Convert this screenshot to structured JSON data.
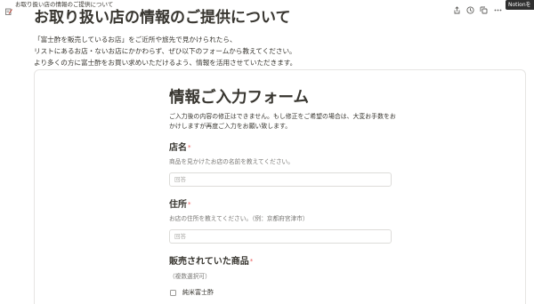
{
  "window": {
    "breadcrumb": "お取り扱い店の情報のご提供について",
    "breadcrumb_icon": "note-pencil-icon"
  },
  "topbar": {
    "icons": [
      "share-icon",
      "history-icon",
      "copy-icon",
      "more-icon"
    ],
    "notion_button": "Notionを"
  },
  "page": {
    "title": "お取り扱い店の情報のご提供について",
    "paragraphs": [
      "「富士酢を販売しているお店」をご近所や旅先で見かけられたら、",
      "リストにあるお店・ないお店にかかわらず、ぜひ以下のフォームから教えてください。",
      "より多くの方に富士酢をお買い求めいただけるよう、情報を活用させていただきます。"
    ]
  },
  "form": {
    "title": "情報ご入力フォーム",
    "description_lines": [
      "ご入力後の内容の修正はできません。もし修正をご希望の場合は、大変お手数をお",
      "かけしますが再度ご入力をお願い致します。"
    ],
    "fields": [
      {
        "label": "店名",
        "required_mark": "*",
        "help": "商品を見かけたお店の名前を教えてください。",
        "placeholder": "回答"
      },
      {
        "label": "住所",
        "required_mark": "*",
        "help": "お店の住所を教えてください。（例：京都府宮津市）",
        "placeholder": "回答"
      },
      {
        "label": "販売されていた商品",
        "required_mark": "*",
        "help": "（複数選択可）",
        "options": [
          "純米富士酢"
        ]
      }
    ]
  },
  "colors": {
    "text": "#37352f",
    "muted": "#787774",
    "required": "#eb5757",
    "button_bg": "#2f2f2f",
    "border": "#e6e5e3"
  }
}
